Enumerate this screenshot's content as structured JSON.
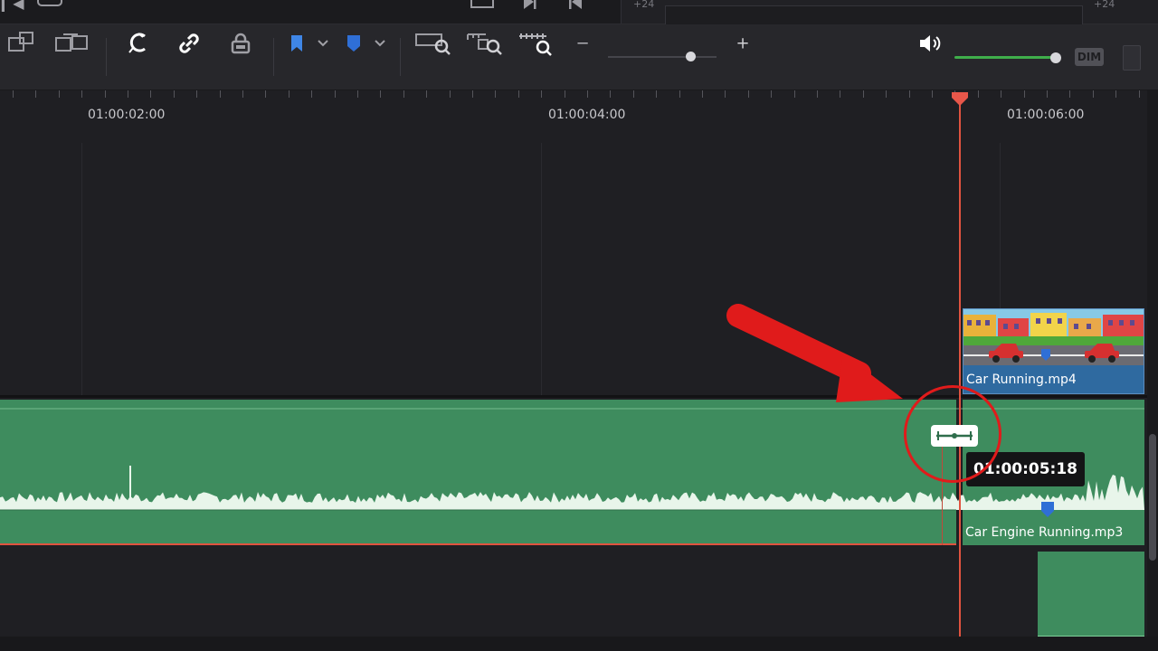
{
  "top_strip": {
    "frame_offset_left": "+24",
    "frame_offset_right": "+24"
  },
  "toolbar": {
    "icons": [
      "replace-clip-icon",
      "swap-clip-icon",
      "snapping-icon",
      "link-clips-icon",
      "position-lock-icon",
      "flag-icon",
      "flag-dropdown-icon",
      "marker-icon",
      "marker-dropdown-icon",
      "zoom-full-icon",
      "zoom-detail-icon",
      "zoom-custom-icon",
      "zoom-out-icon",
      "zoom-in-icon",
      "volume-icon"
    ],
    "zoom_minus": "−",
    "zoom_plus": "+",
    "zoom_level": 0.76,
    "volume_level": 1.0,
    "dim_label": "DIM",
    "flag_color": "#3f86e6",
    "marker_color": "#2f6fd6"
  },
  "ruler": {
    "timecodes": [
      "01:00:02:00",
      "01:00:04:00",
      "01:00:06:00"
    ]
  },
  "playhead": {
    "color": "#e0533f",
    "timecode": "01:00:05:18"
  },
  "clips": {
    "video": {
      "name": "Car Running.mp4",
      "color": "#2f6aa0"
    },
    "audio": {
      "name": "Car Engine Running.mp3",
      "color": "#3e8c5e"
    }
  },
  "annotation": {
    "arrow_color": "#e01b1b",
    "highlight": "razor-cut"
  }
}
